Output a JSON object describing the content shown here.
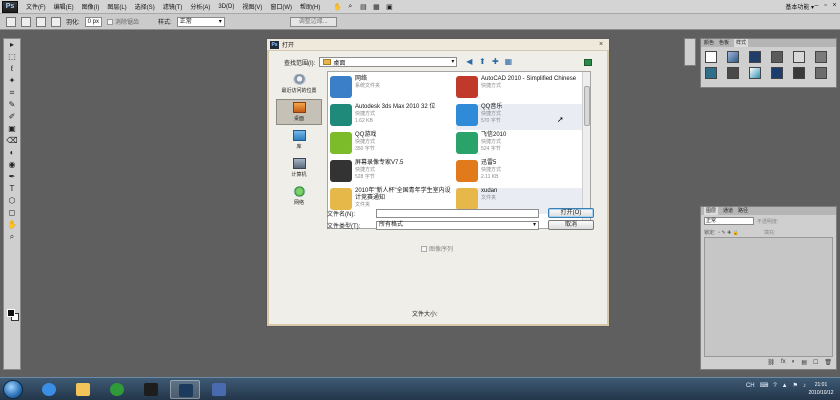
{
  "app": {
    "logo_text": "Ps",
    "menu": [
      "文件(F)",
      "编辑(E)",
      "图像(I)",
      "图层(L)",
      "选择(S)",
      "滤镜(T)",
      "分析(A)",
      "3D(D)",
      "视图(V)",
      "窗口(W)",
      "帮助(H)"
    ],
    "workspace_label": "基本功能 ▾",
    "window_controls": [
      "–",
      "▫",
      "×"
    ]
  },
  "options_bar": {
    "feather_label": "羽化:",
    "feather_value": "0 px",
    "antialias_label": "消除锯齿",
    "style_label": "样式:",
    "style_value": "正常",
    "refine_edge": "调整边缘..."
  },
  "tools": [
    "▸",
    "⬚",
    "ℓ",
    "✦",
    "⌗",
    "✎",
    "✐",
    "▣",
    "⌫",
    "◐",
    "◉",
    "✒",
    "T",
    "⬡",
    "◻",
    "✋",
    "⌕"
  ],
  "swatches_panel": {
    "tabs": [
      "颜色",
      "色板",
      "样式"
    ]
  },
  "layers_panel": {
    "tabs": [
      "图层",
      "通道",
      "路径"
    ],
    "blend_mode": "正常",
    "opacity_label": "不透明度:",
    "lock_label": "锁定:",
    "fill_label": "填充:",
    "footer_icons": [
      "⛓",
      "fx",
      "◐",
      "▤",
      "☐",
      "🗑"
    ]
  },
  "dialog": {
    "title": "打开",
    "close": "×",
    "look_in_label": "查找范围(I):",
    "look_in_value": "桌面",
    "look_in_tools": [
      "◀",
      "⬆",
      "✚",
      "▦"
    ],
    "places": [
      {
        "label": "最近访问的位置",
        "icon": "recent-icon"
      },
      {
        "label": "桌面",
        "icon": "desktop-icon"
      },
      {
        "label": "库",
        "icon": "library-icon"
      },
      {
        "label": "计算机",
        "icon": "computer-icon"
      },
      {
        "label": "网络",
        "icon": "network-icon"
      }
    ],
    "files_left": [
      {
        "name": "网络",
        "meta1": "系统文件夹",
        "meta2": "",
        "color": "#3b7fc8"
      },
      {
        "name": "Autodesk 3ds Max 2010 32 位",
        "meta1": "快捷方式",
        "meta2": "1.62 KB",
        "color": "#1f8a7a"
      },
      {
        "name": "QQ游戏",
        "meta1": "快捷方式",
        "meta2": "350 字节",
        "color": "#7cbb2a"
      },
      {
        "name": "屏幕录像专家V7.5",
        "meta1": "快捷方式",
        "meta2": "528 字节",
        "color": "#333333"
      },
      {
        "name": "2010年\"新人杯\"全国青年学生室内设计竞赛通知",
        "meta1": "文件夹",
        "meta2": "",
        "color": "#e6b84a"
      }
    ],
    "files_right": [
      {
        "name": "AutoCAD 2010 - Simplified Chinese",
        "meta1": "快捷方式",
        "meta2": "",
        "color": "#c0392b"
      },
      {
        "name": "QQ音乐",
        "meta1": "快捷方式",
        "meta2": "570 字节",
        "color": "#2f8ad8"
      },
      {
        "name": "飞信2010",
        "meta1": "快捷方式",
        "meta2": "524 字节",
        "color": "#2aa36a"
      },
      {
        "name": "迅雷5",
        "meta1": "快捷方式",
        "meta2": "2.11 KB",
        "color": "#e07a1a"
      },
      {
        "name": "xudan",
        "meta1": "文件夹",
        "meta2": "",
        "color": "#e6b84a"
      }
    ],
    "filename_label": "文件名(N):",
    "filename_value": "",
    "filetype_label": "文件类型(T):",
    "filetype_value": "所有格式",
    "open_button": "打开(O)",
    "cancel_button": "取消",
    "sequence_label": "图像序列",
    "filesize_label": "文件大小:"
  },
  "taskbar": {
    "apps": [
      {
        "name": "ie",
        "color": "#3a8ee6"
      },
      {
        "name": "explorer",
        "color": "#f2c45a"
      },
      {
        "name": "media",
        "color": "#2f9a3a"
      },
      {
        "name": "player",
        "color": "#1d1d1d"
      },
      {
        "name": "photoshop",
        "color": "#1b3a5c"
      },
      {
        "name": "other",
        "color": "#4a6ab0"
      }
    ],
    "tray_lang": "CH",
    "tray_icons": [
      "⌨",
      "?",
      "▲",
      "⚑",
      "♪"
    ],
    "time": "21:01",
    "date": "2010/10/12"
  }
}
